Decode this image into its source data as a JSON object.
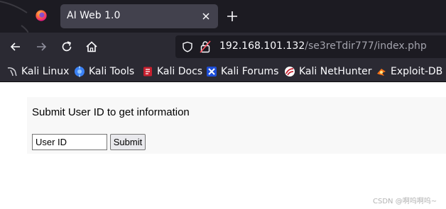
{
  "browser": {
    "tab": {
      "title": "AI Web 1.0",
      "close_icon": "close-icon"
    },
    "new_tab_icon": "plus-icon",
    "nav": {
      "back": "back-arrow-icon",
      "forward": "forward-arrow-icon",
      "reload": "reload-icon",
      "home": "home-icon"
    },
    "url": {
      "host": "192.168.101.132",
      "path": "/se3reTdir777/index.php"
    },
    "bookmarks": [
      {
        "label": "Kali Linux",
        "icon": "kali-dragon-icon"
      },
      {
        "label": "Kali Tools",
        "icon": "kali-tools-icon"
      },
      {
        "label": "Kali Docs",
        "icon": "kali-docs-icon"
      },
      {
        "label": "Kali Forums",
        "icon": "kali-forums-icon"
      },
      {
        "label": "Kali NetHunter",
        "icon": "kali-nethunter-icon"
      },
      {
        "label": "Exploit-DB",
        "icon": "exploit-db-icon"
      }
    ]
  },
  "page": {
    "heading": "Submit User ID to get information",
    "input": {
      "value": "User ID"
    },
    "submit_label": "Submit"
  },
  "watermark": "CSDN @啊呜啊呜~"
}
